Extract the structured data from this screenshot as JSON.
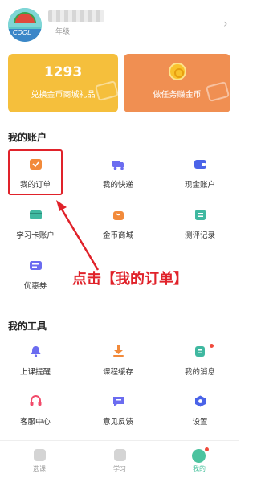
{
  "profile": {
    "grade": "一年级",
    "avatar_text": "COOL"
  },
  "cards": {
    "coins": {
      "amount": "1293",
      "label": "兑换金币商城礼品"
    },
    "tasks": {
      "label": "做任务赚金币"
    }
  },
  "account": {
    "title": "我的账户",
    "items": [
      {
        "label": "我的订单",
        "icon": "order-icon"
      },
      {
        "label": "我的快递",
        "icon": "delivery-truck-icon"
      },
      {
        "label": "现金账户",
        "icon": "wallet-icon"
      },
      {
        "label": "学习卡账户",
        "icon": "card-icon"
      },
      {
        "label": "金币商城",
        "icon": "shop-bag-icon"
      },
      {
        "label": "测评记录",
        "icon": "clipboard-icon"
      },
      {
        "label": "优惠券",
        "icon": "coupon-icon"
      }
    ]
  },
  "tools": {
    "title": "我的工具",
    "items": [
      {
        "label": "上课提醒",
        "icon": "bell-icon"
      },
      {
        "label": "课程缓存",
        "icon": "download-icon"
      },
      {
        "label": "我的消息",
        "icon": "message-icon"
      },
      {
        "label": "客服中心",
        "icon": "headset-icon"
      },
      {
        "label": "意见反馈",
        "icon": "feedback-icon"
      },
      {
        "label": "设置",
        "icon": "settings-icon"
      }
    ]
  },
  "annotation": {
    "text": "点击【我的订单】"
  },
  "nav": {
    "items": [
      {
        "label": "选课"
      },
      {
        "label": "学习"
      },
      {
        "label": "我的",
        "active": true
      }
    ]
  },
  "colors": {
    "accent": "#4cc39f",
    "annotation_red": "#e0222a",
    "coins_card": "#f5bf3c",
    "tasks_card": "#f08f52",
    "icon_orange": "#f28a3a",
    "icon_purple": "#6b6cf0",
    "icon_teal": "#3fb8a0"
  }
}
